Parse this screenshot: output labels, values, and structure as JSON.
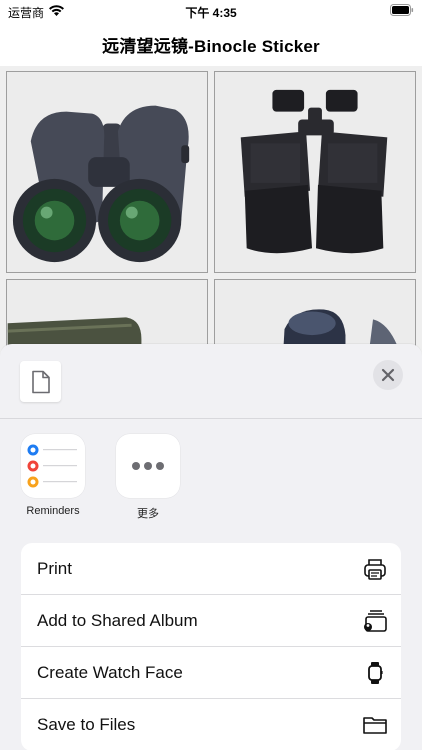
{
  "statusbar": {
    "carrier": "运营商",
    "time": "下午 4:35"
  },
  "nav": {
    "title": "远清望远镜-Binocle Sticker"
  },
  "share_sheet": {
    "apps": [
      {
        "label": "Reminders",
        "icon": "reminders-icon"
      },
      {
        "label": "更多",
        "icon": "more-icon"
      }
    ],
    "actions": [
      {
        "label": "Print",
        "icon": "printer-icon"
      },
      {
        "label": "Add to Shared Album",
        "icon": "shared-album-icon"
      },
      {
        "label": "Create Watch Face",
        "icon": "watch-icon"
      },
      {
        "label": "Save to Files",
        "icon": "folder-icon"
      }
    ]
  },
  "colors": {
    "reminder_blue": "#1e7cf2",
    "reminder_red": "#f0443a",
    "reminder_orange": "#f8a21c",
    "sheet_bg": "#f1f1f4"
  }
}
